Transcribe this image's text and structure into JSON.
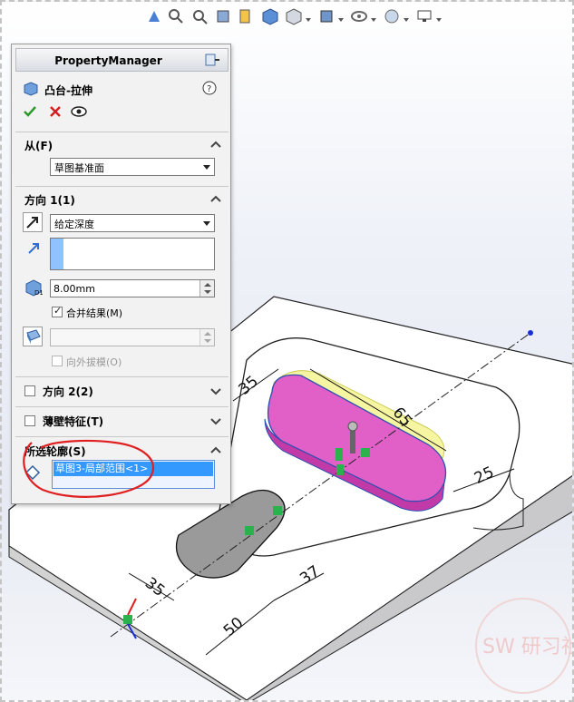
{
  "property_manager": {
    "header": "PropertyManager",
    "feature_title": "凸台-拉伸",
    "sections": {
      "from": {
        "title": "从(F)",
        "select_value": "草图基准面"
      },
      "direction1": {
        "title": "方向 1(1)",
        "end_condition": "给定深度",
        "depth_value": "8.00mm",
        "merge_result_label": "合并结果(M)",
        "merge_result_checked": true,
        "draft_outward_label": "向外拔模(O)"
      },
      "direction2": {
        "title": "方向 2(2)"
      },
      "thin_feature": {
        "title": "薄壁特征(T)"
      },
      "selected_contours": {
        "title": "所选轮廓(S)",
        "items": [
          "草图3-局部范围<1>"
        ]
      }
    }
  },
  "dimensions": {
    "d35_top": "35",
    "d65": "65",
    "d25": "25",
    "d35_bottom": "35",
    "d37": "37",
    "d50": "50"
  },
  "watermark": {
    "text": "SW 研习社"
  },
  "colors": {
    "accent_blue": "#3399ff",
    "extrude_magenta": "#e060c8",
    "preview_yellow": "#f2f07a",
    "annotation_red": "#e02020"
  }
}
